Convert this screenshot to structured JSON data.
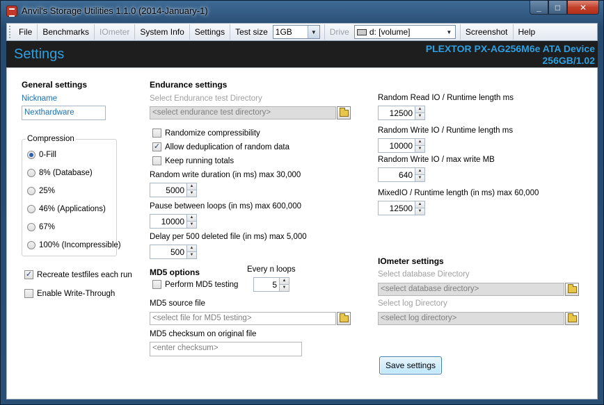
{
  "window": {
    "title": "Anvil's Storage Utilities 1.1.0 (2014-January-1)",
    "minimize": "_",
    "maximize": "□",
    "close": "✕"
  },
  "menu": {
    "file": "File",
    "benchmarks": "Benchmarks",
    "iometer": "IOmeter",
    "system_info": "System Info",
    "settings": "Settings",
    "test_size_label": "Test size",
    "test_size_value": "1GB",
    "drive_label": "Drive",
    "drive_value": "d: [volume]",
    "screenshot": "Screenshot",
    "help": "Help"
  },
  "header": {
    "title": "Settings",
    "device_name": "PLEXTOR PX-AG256M6e ATA Device",
    "device_info": "256GB/1.02",
    "accent_color": "#2ea0e0"
  },
  "general": {
    "heading": "General settings",
    "nickname_label": "Nickname",
    "nickname_value": "Nexthardware",
    "compression_label": "Compression",
    "compression_options": [
      {
        "label": "0-Fill",
        "selected": true
      },
      {
        "label": "8% (Database)",
        "selected": false
      },
      {
        "label": "25%",
        "selected": false
      },
      {
        "label": "46% (Applications)",
        "selected": false
      },
      {
        "label": "67%",
        "selected": false
      },
      {
        "label": "100% (Incompressible)",
        "selected": false
      }
    ],
    "recreate_label": "Recreate testfiles each run",
    "recreate_checked": "✓",
    "write_through_label": "Enable Write-Through",
    "write_through_checked": ""
  },
  "endurance": {
    "heading": "Endurance settings",
    "dir_label": "Select Endurance test Directory",
    "dir_placeholder": "<select endurance test directory>",
    "randomize_label": "Randomize compressibility",
    "randomize_checked": "",
    "dedup_label": "Allow deduplication of random data",
    "dedup_checked": "✓",
    "running_totals_label": "Keep running totals",
    "running_totals_checked": "",
    "write_duration_label": "Random write duration (in ms) max 30,000",
    "write_duration_value": "5000",
    "pause_label": "Pause between loops (in ms) max 600,000",
    "pause_value": "10000",
    "delay_label": "Delay per 500 deleted file (in ms) max 5,000",
    "delay_value": "500"
  },
  "md5": {
    "heading": "MD5 options",
    "every_label": "Every n loops",
    "every_value": "5",
    "perform_label": "Perform MD5 testing",
    "perform_checked": "",
    "source_label": "MD5 source file",
    "source_placeholder": "<select file for MD5 testing>",
    "checksum_label": "MD5 checksum on original file",
    "checksum_placeholder": "<enter checksum>"
  },
  "runtime": {
    "read_label": "Random Read IO / Runtime length ms",
    "read_value": "12500",
    "write_label": "Random Write IO / Runtime length ms",
    "write_value": "10000",
    "write_mb_label": "Random Write IO / max write MB",
    "write_mb_value": "640",
    "mixed_label": "MixedIO / Runtime length (in ms) max 60,000",
    "mixed_value": "12500"
  },
  "iometer": {
    "heading": "IOmeter settings",
    "db_label": "Select database Directory",
    "db_placeholder": "<select database directory>",
    "log_label": "Select log Directory",
    "log_placeholder": "<select log directory>"
  },
  "actions": {
    "save": "Save settings"
  }
}
